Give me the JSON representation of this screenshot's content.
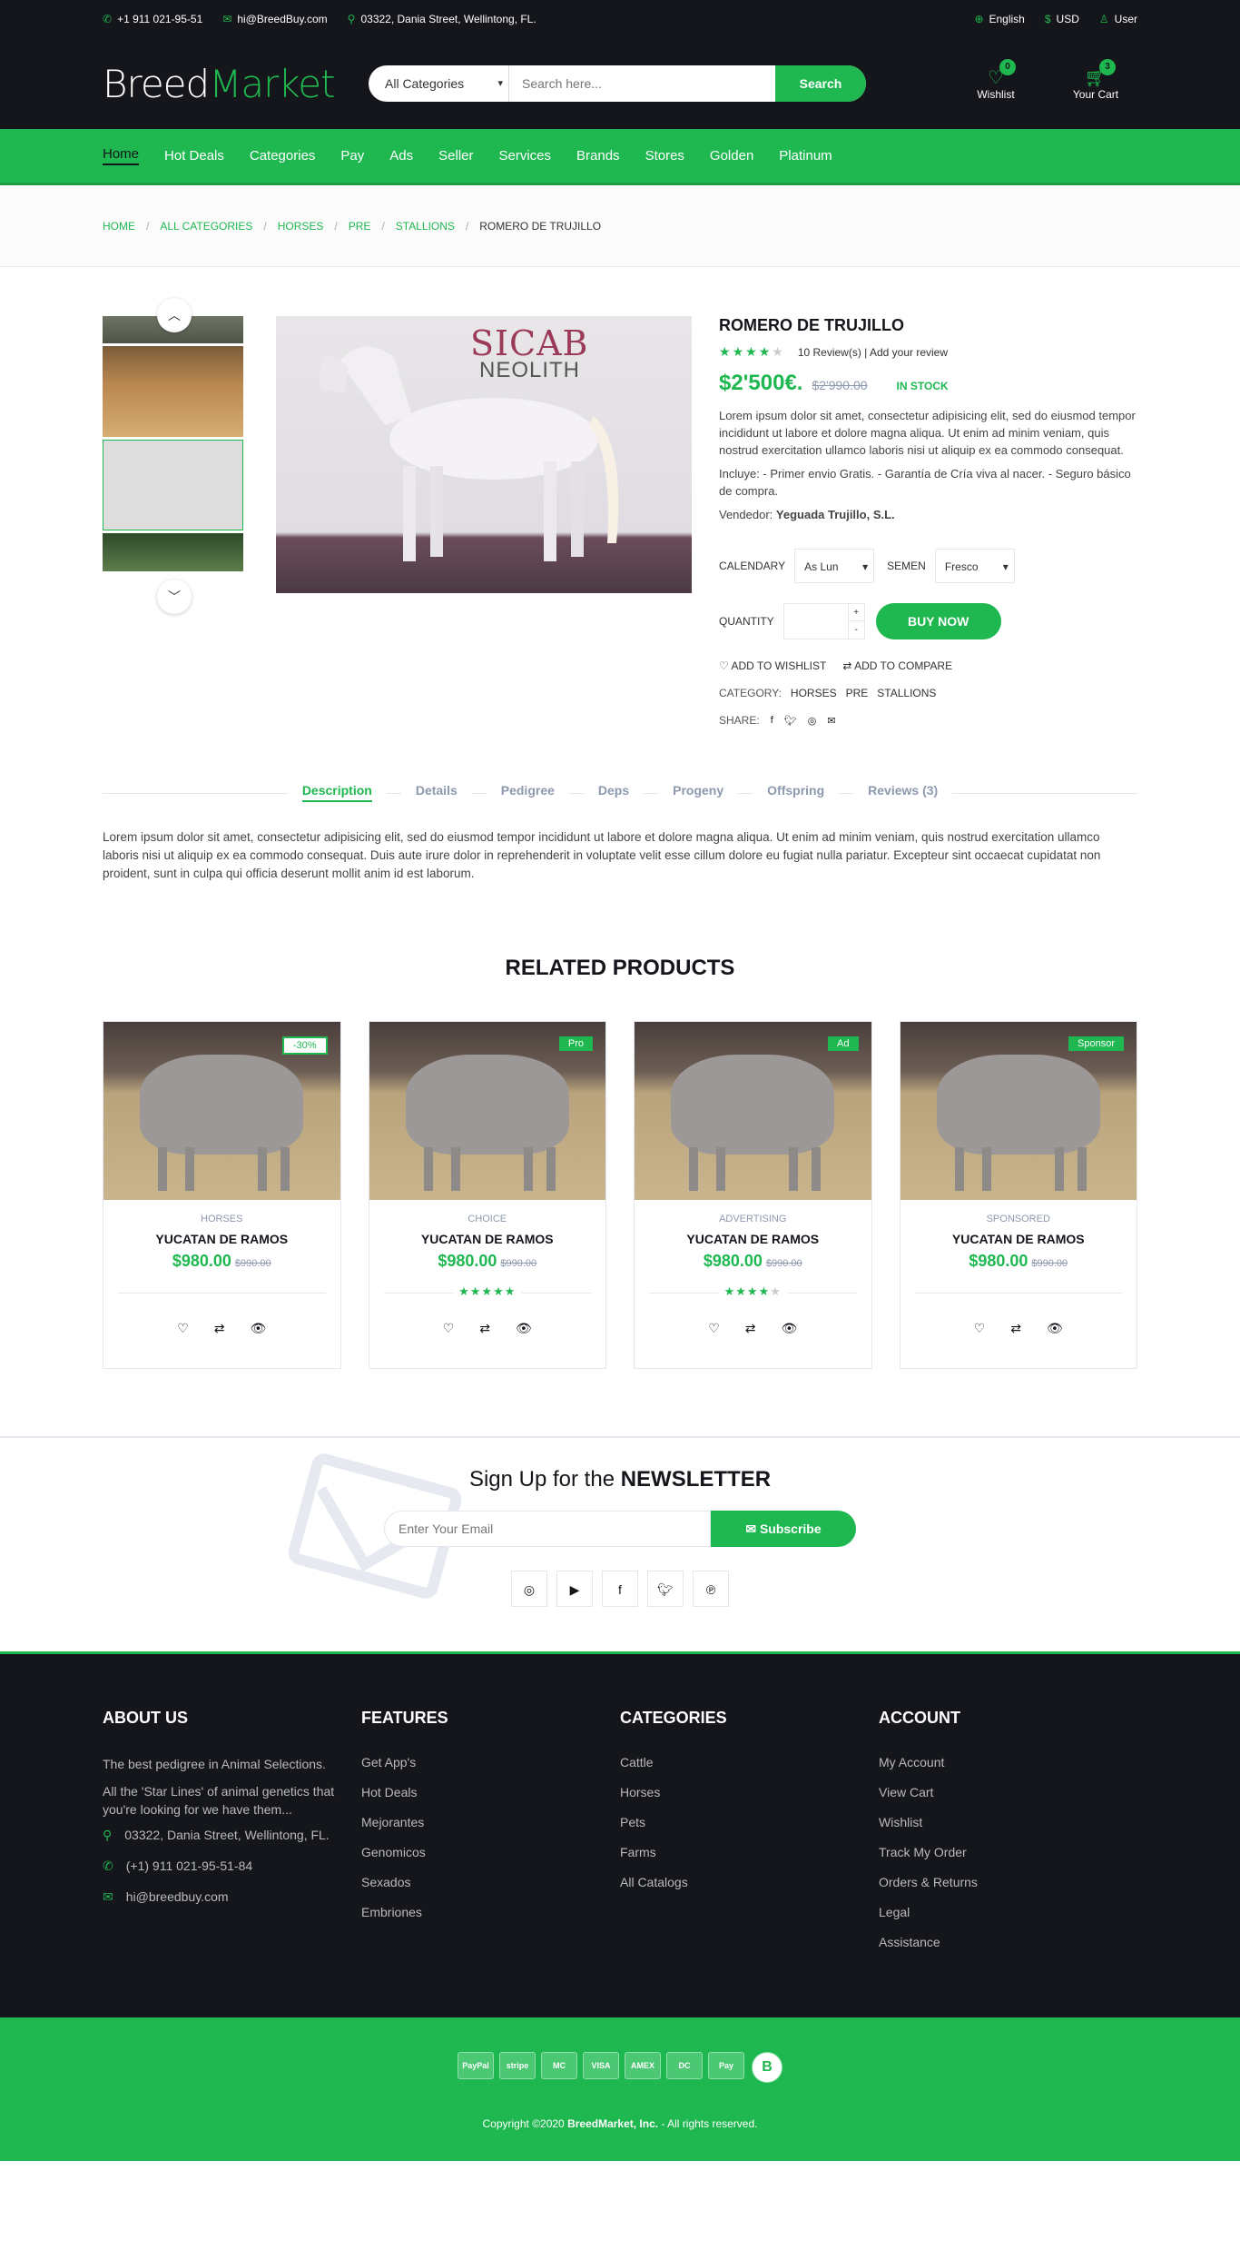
{
  "top_header": {
    "phone": "+1 911 021-95-51",
    "email": "hi@BreedBuy.com",
    "address": "03322, Dania Street, Wellintong, FL.",
    "language": "English",
    "currency": "USD",
    "user": "User"
  },
  "header": {
    "logo_a": "Breed",
    "logo_b": "Market",
    "category_select": "All Categories",
    "search_placeholder": "Search here...",
    "search_button": "Search",
    "wishlist_label": "Wishlist",
    "wishlist_count": "0",
    "cart_label": "Your Cart",
    "cart_count": "3"
  },
  "nav": [
    "Home",
    "Hot Deals",
    "Categories",
    "Pay",
    "Ads",
    "Seller",
    "Services",
    "Brands",
    "Stores",
    "Golden",
    "Platinum"
  ],
  "breadcrumb": [
    "HOME",
    "ALL CATEGORIES",
    "HORSES",
    "PRE",
    "STALLIONS",
    "ROMERO DE TRUJILLO"
  ],
  "product": {
    "main_image_logo": "SICAB",
    "main_image_sub": "NEOLITH",
    "name": "ROMERO DE TRUJILLO",
    "rating": 4,
    "reviews": "10 Review(s) | Add your review",
    "price": "$2'500€.",
    "old_price": "$2'990.00",
    "stock": "IN STOCK",
    "description": "Lorem ipsum dolor sit amet, consectetur adipisicing elit, sed do eiusmod tempor incididunt ut labore et dolore magna aliqua. Ut enim ad minim veniam, quis nostrud exercitation ullamco laboris nisi ut aliquip ex ea commodo consequat.",
    "includes": "Incluye: - Primer envio Gratis. - Garantía de Cría viva al nacer. - Seguro básico de compra.",
    "seller_label": "Vendedor:",
    "seller": "Yeguada Trujillo, S.L.",
    "calendary_label": "CALENDARY",
    "calendary_value": "As Lun",
    "semen_label": "SEMEN",
    "semen_value": "Fresco",
    "quantity_label": "QUANTITY",
    "buy_button": "BUY NOW",
    "wishlist_link": "ADD TO WISHLIST",
    "compare_link": "ADD TO COMPARE",
    "category_label": "CATEGORY:",
    "categories": [
      "HORSES",
      "PRE",
      "STALLIONS"
    ],
    "share_label": "SHARE:"
  },
  "tabs": [
    "Description",
    "Details",
    "Pedigree",
    "Deps",
    "Progeny",
    "Offspring",
    "Reviews (3)"
  ],
  "tab_text": "Lorem ipsum dolor sit amet, consectetur adipisicing elit, sed do eiusmod tempor incididunt ut labore et dolore magna aliqua. Ut enim ad minim veniam, quis nostrud exercitation ullamco laboris nisi ut aliquip ex ea commodo consequat. Duis aute irure dolor in reprehenderit in voluptate velit esse cillum dolore eu fugiat nulla pariatur. Excepteur sint occaecat cupidatat non proident, sunt in culpa qui officia deserunt mollit anim id est laborum.",
  "related": {
    "title": "RELATED PRODUCTS",
    "items": [
      {
        "badge": "-30%",
        "category": "HORSES",
        "name": "YUCATAN DE RAMOS",
        "price": "$980.00",
        "old_price": "$990.00",
        "rating": 0
      },
      {
        "badge": "Pro",
        "category": "CHOICE",
        "name": "YUCATAN DE RAMOS",
        "price": "$980.00",
        "old_price": "$990.00",
        "rating": 5
      },
      {
        "badge": "Ad",
        "category": "ADVERTISING",
        "name": "YUCATAN DE RAMOS",
        "price": "$980.00",
        "old_price": "$990.00",
        "rating": 4
      },
      {
        "badge": "Sponsor",
        "category": "SPONSORED",
        "name": "YUCATAN DE RAMOS",
        "price": "$980.00",
        "old_price": "$990.00",
        "rating": 0
      }
    ]
  },
  "newsletter": {
    "title_a": "Sign Up for the ",
    "title_b": "NEWSLETTER",
    "placeholder": "Enter Your Email",
    "button": "Subscribe"
  },
  "footer": {
    "about_title": "ABOUT US",
    "about_1": "The best pedigree in Animal Selections.",
    "about_2": "All the 'Star Lines' of animal genetics that you're looking for we have them...",
    "address": "03322, Dania Street, Wellintong, FL.",
    "phone": "(+1) 911 021-95-51-84",
    "email": "hi@breedbuy.com",
    "features_title": "FEATURES",
    "features": [
      "Get App's",
      "Hot Deals",
      "Mejorantes",
      "Genomicos",
      "Sexados",
      "Embriones"
    ],
    "categories_title": "CATEGORIES",
    "categories": [
      "Cattle",
      "Horses",
      "Pets",
      "Farms",
      "All Catalogs"
    ],
    "account_title": "ACCOUNT",
    "account": [
      "My Account",
      "View Cart",
      "Wishlist",
      "Track My Order",
      "Orders & Returns",
      "Legal",
      "Assistance"
    ]
  },
  "payments": [
    "PayPal",
    "stripe",
    "MC",
    "VISA",
    "AMEX",
    "DC",
    "Pay",
    "B"
  ],
  "copyright_a": "Copyright ©2020 ",
  "copyright_b": "BreedMarket, Inc.",
  "copyright_c": " - All rights reserved.",
  "colors": {
    "accent": "#1fb850",
    "dark": "#15161b"
  }
}
